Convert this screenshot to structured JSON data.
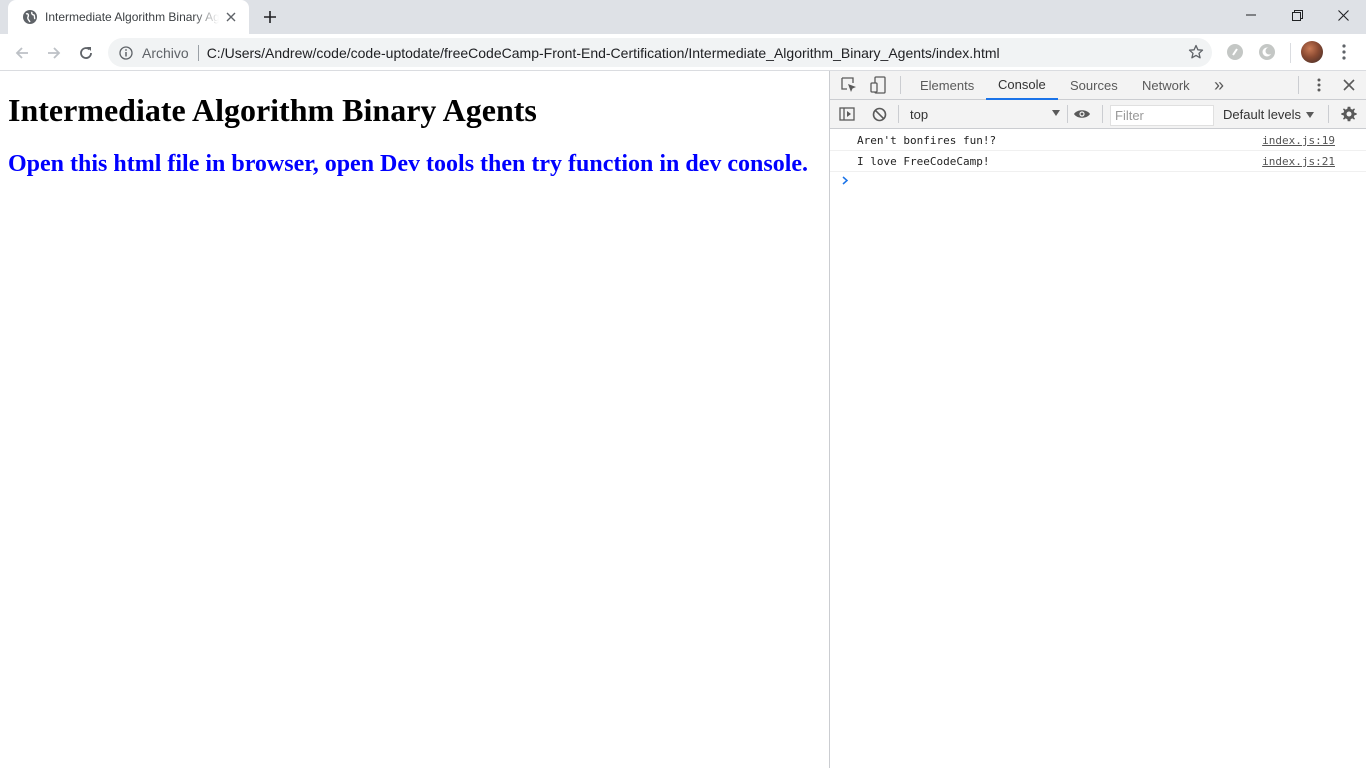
{
  "browser": {
    "tab": {
      "title": "Intermediate Algorithm Binary Agents"
    },
    "omnibox": {
      "chip_label": "Archivo",
      "url": "C:/Users/Andrew/code/code-uptodate/freeCodeCamp-Front-End-Certification/Intermediate_Algorithm_Binary_Agents/index.html"
    }
  },
  "page": {
    "heading": "Intermediate Algorithm Binary Agents",
    "subheading": "Open this html file in browser, open Dev tools then try function in dev console."
  },
  "devtools": {
    "tabs": [
      {
        "label": "Elements"
      },
      {
        "label": "Console"
      },
      {
        "label": "Sources"
      },
      {
        "label": "Network"
      }
    ],
    "overflow_label": "»",
    "console": {
      "context": "top",
      "filter_placeholder": "Filter",
      "levels_label": "Default levels",
      "messages": [
        {
          "text": "Aren't bonfires fun!?",
          "source": "index.js:19"
        },
        {
          "text": "I love FreeCodeCamp!",
          "source": "index.js:21"
        }
      ]
    }
  },
  "colors": {
    "tabstrip_bg": "#dee1e6",
    "heading_color": "#000000",
    "subheading_color": "#0000ff",
    "devtools_accent": "#1a73e8"
  }
}
